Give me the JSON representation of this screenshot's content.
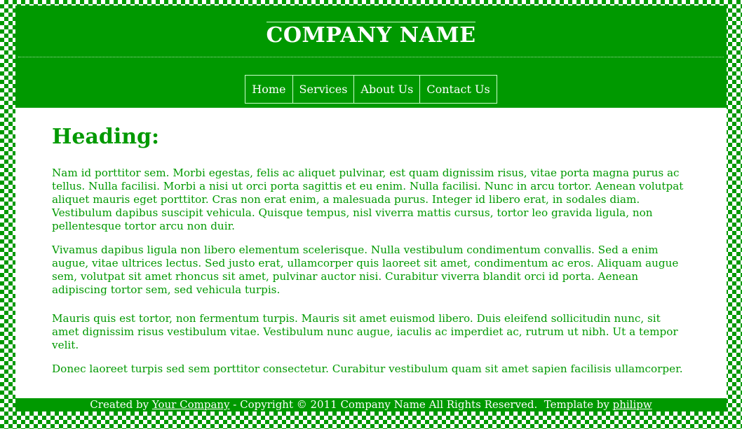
{
  "colors": {
    "primary_green": "#009900",
    "background": "#ffffff",
    "border_light": "#ccffcc"
  },
  "header": {
    "title": "COMPANY NAME"
  },
  "nav": {
    "items": [
      {
        "label": "Home"
      },
      {
        "label": "Services"
      },
      {
        "label": "About Us"
      },
      {
        "label": "Contact Us"
      }
    ]
  },
  "content": {
    "heading": "Heading:",
    "paragraphs": [
      "Nam id porttitor sem. Morbi egestas, felis ac aliquet pulvinar, est quam dignissim risus, vitae porta magna purus ac tellus. Nulla facilisi. Morbi a nisi ut orci porta sagittis et eu enim. Nulla facilisi. Nunc in arcu tortor. Aenean volutpat aliquet mauris eget porttitor. Cras non erat enim, a malesuada purus. Integer id libero erat, in sodales diam. Vestibulum dapibus suscipit vehicula. Quisque tempus, nisl viverra mattis cursus, tortor leo gravida ligula, non pellentesque tortor arcu non duir.",
      "Vivamus dapibus ligula non libero elementum scelerisque. Nulla vestibulum condimentum convallis. Sed a enim augue, vitae ultrices lectus. Sed justo erat, ullamcorper quis laoreet sit amet, condimentum ac eros. Aliquam augue sem, volutpat sit amet rhoncus sit amet, pulvinar auctor nisi. Curabitur viverra blandit orci id porta. Aenean adipiscing tortor sem, sed vehicula turpis.",
      "Mauris quis est tortor, non fermentum turpis. Mauris sit amet euismod libero. Duis eleifend sollicitudin nunc, sit amet dignissim risus vestibulum vitae. Vestibulum nunc augue, iaculis ac imperdiet ac, rutrum ut nibh. Ut a tempor velit.",
      "Donec laoreet turpis sed sem porttitor consectetur. Curabitur vestibulum quam sit amet sapien facilisis ullamcorper."
    ]
  },
  "footer": {
    "prefix": "Created by ",
    "company_link": "Your Company",
    "copyright": " - Copyright © 2011 Company Name All Rights Reserved.  Template by ",
    "author_link": "philipw"
  }
}
